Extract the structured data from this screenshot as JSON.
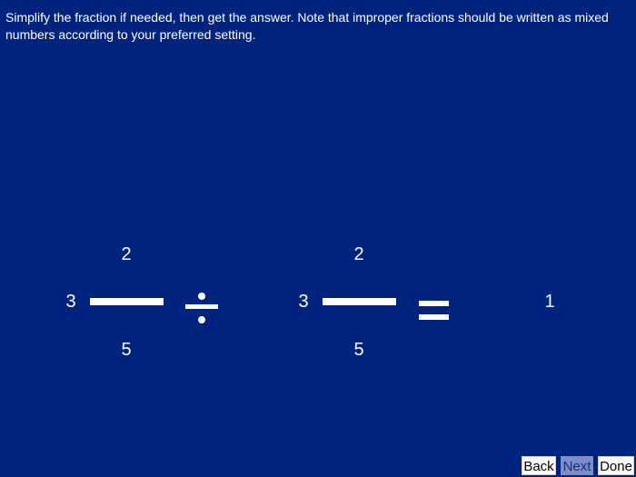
{
  "instruction": "Simplify the fraction if needed, then get the answer. Note that improper fractions should be written as mixed numbers according to your preferred setting.",
  "problem": {
    "first": {
      "whole": "3",
      "numerator": "2",
      "denominator": "5"
    },
    "operator": "division-sign",
    "second": {
      "whole": "3",
      "numerator": "2",
      "denominator": "5"
    },
    "equals": "equals-sign",
    "answer": "1"
  },
  "buttons": {
    "back": "Back",
    "next": "Next",
    "done": "Done"
  },
  "colors": {
    "background": "#00247d",
    "text": "#ffffff",
    "button_bg": "#ffffff",
    "button_disabled_bg": "#7e8ec8"
  }
}
